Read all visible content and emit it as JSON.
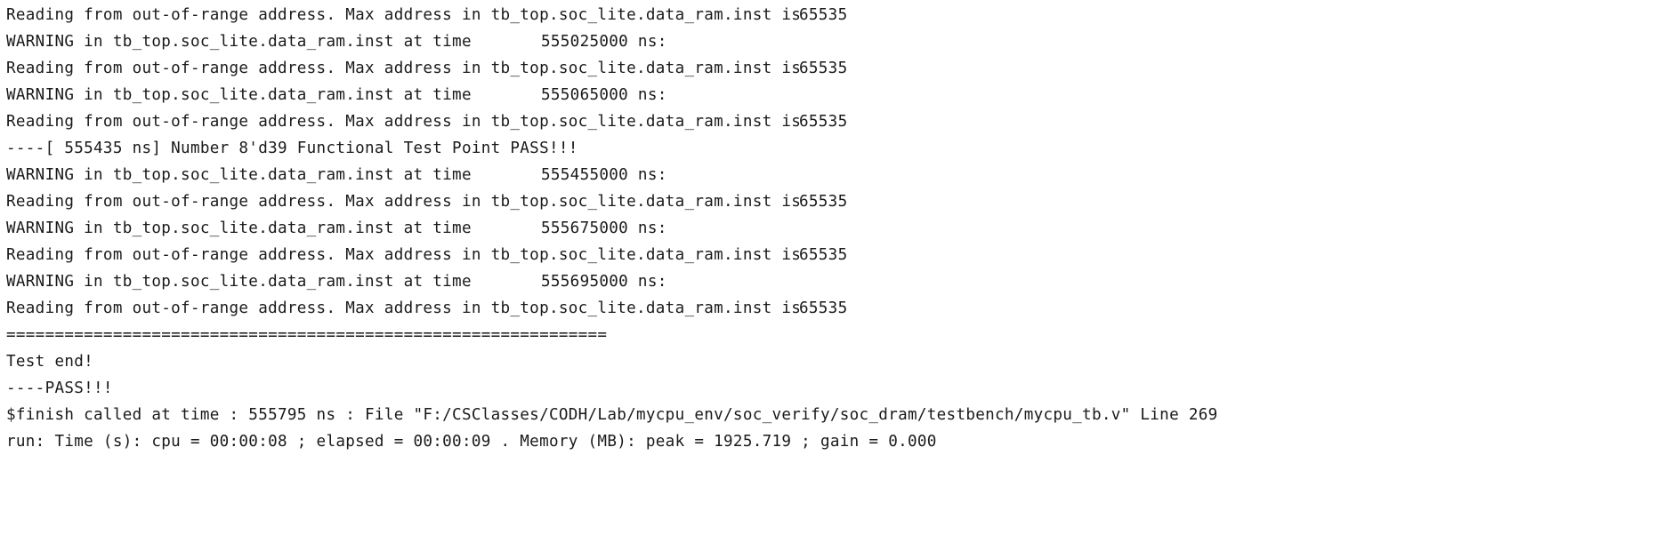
{
  "console": {
    "lines": [
      {
        "type": "read",
        "msg": "Reading from out-of-range address. Max address in tb_top.soc_lite.data_ram.inst is",
        "value": "65535"
      },
      {
        "type": "warn",
        "msg": "WARNING in tb_top.soc_lite.data_ram.inst at time",
        "value": "555025000 ns:"
      },
      {
        "type": "read",
        "msg": "Reading from out-of-range address. Max address in tb_top.soc_lite.data_ram.inst is",
        "value": "65535"
      },
      {
        "type": "warn",
        "msg": "WARNING in tb_top.soc_lite.data_ram.inst at time",
        "value": "555065000 ns:"
      },
      {
        "type": "read",
        "msg": "Reading from out-of-range address. Max address in tb_top.soc_lite.data_ram.inst is",
        "value": "65535"
      },
      {
        "type": "text",
        "msg": "----[ 555435 ns] Number 8'd39 Functional Test Point PASS!!!"
      },
      {
        "type": "warn",
        "msg": "WARNING in tb_top.soc_lite.data_ram.inst at time",
        "value": "555455000 ns:"
      },
      {
        "type": "read",
        "msg": "Reading from out-of-range address. Max address in tb_top.soc_lite.data_ram.inst is",
        "value": "65535"
      },
      {
        "type": "warn",
        "msg": "WARNING in tb_top.soc_lite.data_ram.inst at time",
        "value": "555675000 ns:"
      },
      {
        "type": "read",
        "msg": "Reading from out-of-range address. Max address in tb_top.soc_lite.data_ram.inst is",
        "value": "65535"
      },
      {
        "type": "warn",
        "msg": "WARNING in tb_top.soc_lite.data_ram.inst at time",
        "value": "555695000 ns:"
      },
      {
        "type": "read",
        "msg": "Reading from out-of-range address. Max address in tb_top.soc_lite.data_ram.inst is",
        "value": "65535"
      },
      {
        "type": "text",
        "msg": "=============================================================="
      },
      {
        "type": "text",
        "msg": "Test end!"
      },
      {
        "type": "text",
        "msg": "----PASS!!!"
      },
      {
        "type": "text",
        "msg": "$finish called at time : 555795 ns : File \"F:/CSClasses/CODH/Lab/mycpu_env/soc_verify/soc_dram/testbench/mycpu_tb.v\" Line 269"
      },
      {
        "type": "text",
        "msg": "run: Time (s): cpu = 00:00:08 ; elapsed = 00:00:09 . Memory (MB): peak = 1925.719 ; gain = 0.000"
      }
    ]
  }
}
